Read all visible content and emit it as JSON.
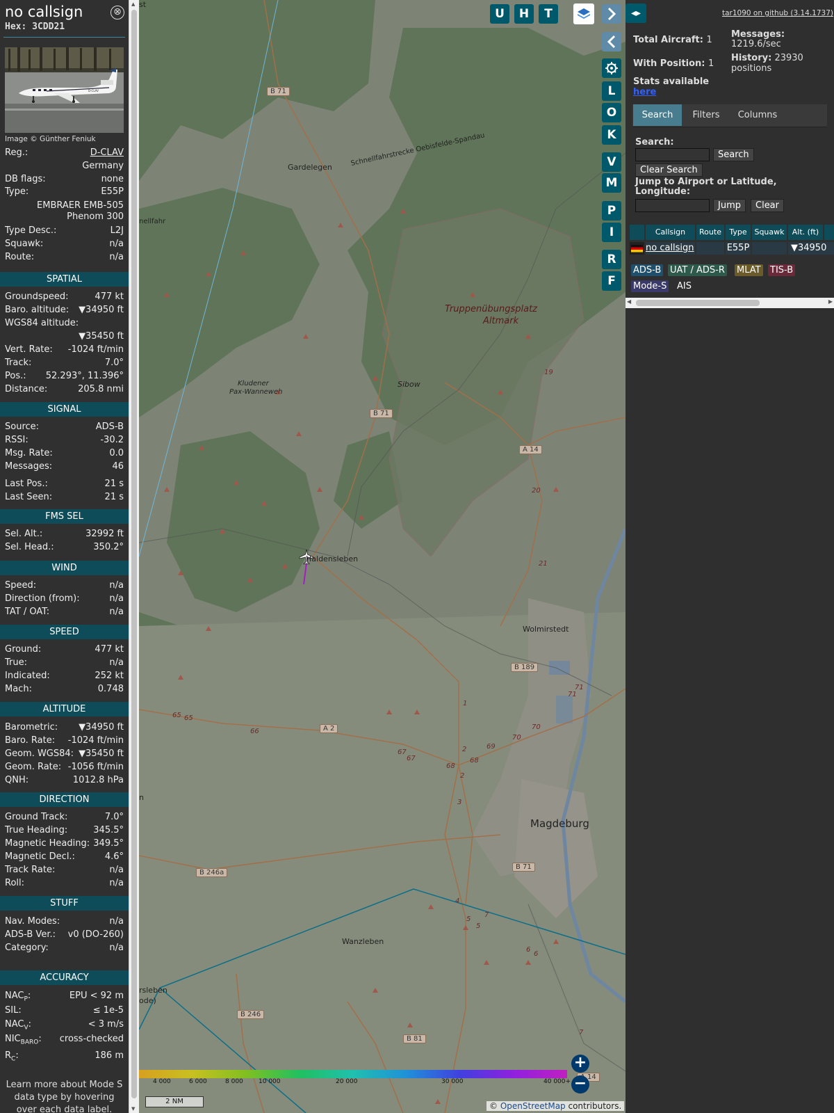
{
  "panel": {
    "title": "no callsign",
    "hex": "Hex: 3CDD21",
    "close_glyph": "⊗",
    "image_credit": "Image © Günther Feniuk",
    "photo_reg": "D-CLAV",
    "rows": {
      "reg_label": "Reg.:",
      "reg_value": "D-CLAV",
      "country": "Germany",
      "dbflags_label": "DB flags:",
      "dbflags_value": "none",
      "type_label": "Type:",
      "type_value": "E55P",
      "type_name1": "EMBRAER EMB-505",
      "type_name2": "Phenom 300",
      "typedesc_label": "Type Desc.:",
      "typedesc_value": "L2J",
      "squawk_label": "Squawk:",
      "squawk_value": "n/a",
      "route_label": "Route:",
      "route_value": "n/a"
    },
    "spatial": {
      "header": "SPATIAL",
      "groundspeed_label": "Groundspeed:",
      "groundspeed_value": "477 kt",
      "baro_label": "Baro. altitude:",
      "baro_value": "▼34950 ft",
      "wgs_label": "WGS84 altitude:",
      "wgs_value": "▼35450 ft",
      "vrate_label": "Vert. Rate:",
      "vrate_value": "-1024 ft/min",
      "track_label": "Track:",
      "track_value": "7.0°",
      "pos_label": "Pos.:",
      "pos_value": "52.293°, 11.396°",
      "dist_label": "Distance:",
      "dist_value": "205.8 nmi"
    },
    "signal": {
      "header": "SIGNAL",
      "source_label": "Source:",
      "source_value": "ADS-B",
      "rssi_label": "RSSI:",
      "rssi_value": "-30.2",
      "msgrate_label": "Msg. Rate:",
      "msgrate_value": "0.0",
      "messages_label": "Messages:",
      "messages_value": "46",
      "lastpos_label": "Last Pos.:",
      "lastpos_value": "21 s",
      "lastseen_label": "Last Seen:",
      "lastseen_value": "21 s"
    },
    "fms": {
      "header": "FMS SEL",
      "selalt_label": "Sel. Alt.:",
      "selalt_value": "32992 ft",
      "selhead_label": "Sel. Head.:",
      "selhead_value": "350.2°"
    },
    "wind": {
      "header": "WIND",
      "speed_label": "Speed:",
      "speed_value": "n/a",
      "dir_label": "Direction (from):",
      "dir_value": "n/a",
      "tat_label": "TAT / OAT:",
      "tat_value": "n/a"
    },
    "speed": {
      "header": "SPEED",
      "ground_label": "Ground:",
      "ground_value": "477 kt",
      "true_label": "True:",
      "true_value": "n/a",
      "ind_label": "Indicated:",
      "ind_value": "252 kt",
      "mach_label": "Mach:",
      "mach_value": "0.748"
    },
    "altitude": {
      "header": "ALTITUDE",
      "baro_label": "Barometric:",
      "baro_value": "▼34950 ft",
      "barorate_label": "Baro. Rate:",
      "barorate_value": "-1024 ft/min",
      "geom_label": "Geom. WGS84:",
      "geom_value": "▼35450 ft",
      "geomrate_label": "Geom. Rate:",
      "geomrate_value": "-1056 ft/min",
      "qnh_label": "QNH:",
      "qnh_value": "1012.8 hPa"
    },
    "direction": {
      "header": "DIRECTION",
      "gtrack_label": "Ground Track:",
      "gtrack_value": "7.0°",
      "thead_label": "True Heading:",
      "thead_value": "345.5°",
      "mhead_label": "Magnetic Heading:",
      "mhead_value": "349.5°",
      "mdecl_label": "Magnetic Decl.:",
      "mdecl_value": "4.6°",
      "trate_label": "Track Rate:",
      "trate_value": "n/a",
      "roll_label": "Roll:",
      "roll_value": "n/a"
    },
    "stuff": {
      "header": "STUFF",
      "nav_label": "Nav. Modes:",
      "nav_value": "n/a",
      "adsb_label": "ADS-B Ver.:",
      "adsb_value": "v0 (DO-260)",
      "cat_label": "Category:",
      "cat_value": "n/a"
    },
    "accuracy": {
      "header": "ACCURACY",
      "nacp_label": "NAC",
      "nacp_sub": "P",
      "nacp_value": "EPU < 92 m",
      "sil_label": "SIL:",
      "sil_value": "≤ 1e-5",
      "nacv_label": "NAC",
      "nacv_sub": "V",
      "nacv_value": "< 3 m/s",
      "nic_label": "NIC",
      "nic_sub": "BARO",
      "nic_value": "cross-checked",
      "rc_label": "R",
      "rc_sub": "C",
      "rc_value": "186 m"
    },
    "footer_text": "Learn more about Mode S data type by hovering over each data label."
  },
  "map": {
    "top_buttons": [
      "U",
      "H",
      "T"
    ],
    "side_buttons": [
      "L",
      "O",
      "K",
      "V",
      "M",
      "P",
      "I",
      "R",
      "F"
    ],
    "labels": {
      "b71_top": "B 71",
      "gardelegen": "Gardelegen",
      "rail": "Schnellfahrstrecke Oebisfelde-Spandau",
      "nellfahr": "nellfahr",
      "truppen1": "Truppenübungsplatz",
      "truppen2": "Altmark",
      "kludener1": "Kludener",
      "kludener2": "Pax-Wanneweh",
      "sibow": "Sibow",
      "b71_mid": "B 71",
      "a14": "A 14",
      "haldensleben": "Haldensleben",
      "wolmirstedt": "Wolmirstedt",
      "b189": "B 189",
      "a2": "A 2",
      "magdeburg": "Magdeburg",
      "b71_low": "B 71",
      "b246a": "B 246a",
      "wanzleben": "Wanzleben",
      "b246": "B 246",
      "b81": "B 81",
      "a14_low": "A 14",
      "ersleben": "rsleben",
      "ode": "ode)",
      "n_left": "n",
      "st_top": "st",
      "ex19": "19",
      "ex20": "20",
      "ex21": "21",
      "ex65a": "65",
      "ex65b": "65",
      "ex66": "66",
      "ex67a": "67",
      "ex67b": "67",
      "ex68a": "68",
      "ex68b": "68",
      "ex69": "69",
      "ex70a": "70",
      "ex70b": "70",
      "ex71a": "71",
      "ex71b": "71",
      "ex1": "1",
      "ex2a": "2",
      "ex2b": "2",
      "ex3": "3",
      "ex4": "4",
      "ex5a": "5",
      "ex5b": "5",
      "ex6a": "6",
      "ex6b": "6",
      "ex7a": "7",
      "ex7b": "7"
    },
    "altitude_scale": [
      "4 000",
      "6 000",
      "8 000",
      "10 000",
      "20 000",
      "30 000",
      "40 000+"
    ],
    "scale_bar": "2 NM",
    "attribution_prefix": "© ",
    "attribution_link": "OpenStreetMap",
    "attribution_suffix": " contributors.",
    "zoom_in": "+",
    "zoom_out": "−"
  },
  "sidebar": {
    "version_link": "tar1090 on github (3.14.1737)",
    "total_aircraft_label": "Total Aircraft:",
    "total_aircraft_value": "1",
    "with_position_label": "With Position:",
    "with_position_value": "1",
    "messages_label": "Messages:",
    "messages_value": "1219.6/sec",
    "history_label": "History:",
    "history_value": "23930",
    "history_unit": "positions",
    "stats_text": "Stats available",
    "stats_link": "here",
    "tabs": [
      "Search",
      "Filters",
      "Columns"
    ],
    "search_label": "Search:",
    "search_button": "Search",
    "clear_search_button": "Clear Search",
    "jump_label": "Jump to Airport or Latitude, Longitude:",
    "jump_button": "Jump",
    "clear_button": "Clear",
    "table_headers": [
      "Callsign",
      "Route",
      "Type",
      "Squawk",
      "Alt. (ft)"
    ],
    "table_row": {
      "callsign": "no callsign",
      "route": "",
      "type": "E55P",
      "squawk": "",
      "alt": "▼34950"
    },
    "badges": [
      "ADS-B",
      "UAT / ADS-R",
      "MLAT",
      "TIS-B",
      "Mode-S",
      "AIS"
    ],
    "colors": {
      "adsb": "#1f4f6a",
      "uat": "#2d5a4a",
      "mlat": "#6b5a2a",
      "tisb": "#6b2a3a",
      "modes": "#3a3a6a"
    }
  }
}
